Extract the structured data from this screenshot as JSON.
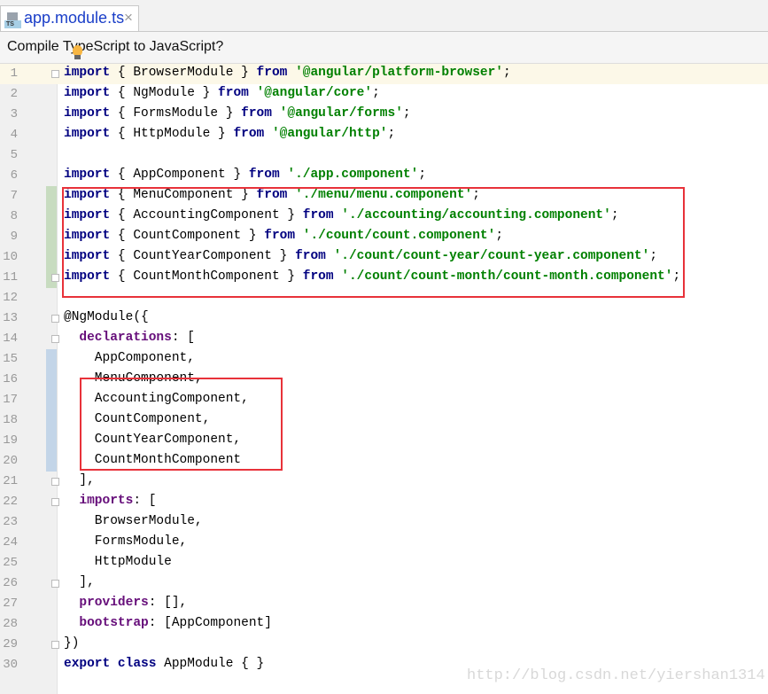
{
  "tab": {
    "title": "app.module.ts",
    "icon_label": "TS",
    "close": "×"
  },
  "notice": {
    "text": "Compile TypeScript to JavaScript?"
  },
  "colors": {
    "keyword": "#000080",
    "string": "#008000",
    "property": "#660e7a",
    "highlight_box": "#e8323a",
    "added_marker": "#c8dcc0",
    "modified_marker": "#c3d5e8"
  },
  "current_line": 1,
  "added_lines": [
    7,
    8,
    9,
    10,
    11
  ],
  "modified_lines": [
    15,
    16,
    17,
    18,
    19,
    20
  ],
  "fold_lines": [
    1,
    11,
    13,
    14,
    21,
    22,
    26,
    29
  ],
  "lines": [
    [
      [
        "kw",
        "import"
      ],
      [
        "p",
        " { BrowserModule } "
      ],
      [
        "kw",
        "from"
      ],
      [
        "p",
        " "
      ],
      [
        "str",
        "'@angular/platform-browser'"
      ],
      [
        "p",
        ";"
      ]
    ],
    [
      [
        "kw",
        "import"
      ],
      [
        "p",
        " { NgModule } "
      ],
      [
        "kw",
        "from"
      ],
      [
        "p",
        " "
      ],
      [
        "str",
        "'@angular/core'"
      ],
      [
        "p",
        ";"
      ]
    ],
    [
      [
        "kw",
        "import"
      ],
      [
        "p",
        " { FormsModule } "
      ],
      [
        "kw",
        "from"
      ],
      [
        "p",
        " "
      ],
      [
        "str",
        "'@angular/forms'"
      ],
      [
        "p",
        ";"
      ]
    ],
    [
      [
        "kw",
        "import"
      ],
      [
        "p",
        " { HttpModule } "
      ],
      [
        "kw",
        "from"
      ],
      [
        "p",
        " "
      ],
      [
        "str",
        "'@angular/http'"
      ],
      [
        "p",
        ";"
      ]
    ],
    [],
    [
      [
        "kw",
        "import"
      ],
      [
        "p",
        " { AppComponent } "
      ],
      [
        "kw",
        "from"
      ],
      [
        "p",
        " "
      ],
      [
        "str",
        "'./app.component'"
      ],
      [
        "p",
        ";"
      ]
    ],
    [
      [
        "kw",
        "import"
      ],
      [
        "p",
        " { MenuComponent } "
      ],
      [
        "kw",
        "from"
      ],
      [
        "p",
        " "
      ],
      [
        "str",
        "'./menu/menu.component'"
      ],
      [
        "p",
        ";"
      ]
    ],
    [
      [
        "kw",
        "import"
      ],
      [
        "p",
        " { AccountingComponent } "
      ],
      [
        "kw",
        "from"
      ],
      [
        "p",
        " "
      ],
      [
        "str",
        "'./accounting/accounting.component'"
      ],
      [
        "p",
        ";"
      ]
    ],
    [
      [
        "kw",
        "import"
      ],
      [
        "p",
        " { CountComponent } "
      ],
      [
        "kw",
        "from"
      ],
      [
        "p",
        " "
      ],
      [
        "str",
        "'./count/count.component'"
      ],
      [
        "p",
        ";"
      ]
    ],
    [
      [
        "kw",
        "import"
      ],
      [
        "p",
        " { CountYearComponent } "
      ],
      [
        "kw",
        "from"
      ],
      [
        "p",
        " "
      ],
      [
        "str",
        "'./count/count-year/count-year.component'"
      ],
      [
        "p",
        ";"
      ]
    ],
    [
      [
        "kw",
        "import"
      ],
      [
        "p",
        " { CountMonthComponent } "
      ],
      [
        "kw",
        "from"
      ],
      [
        "p",
        " "
      ],
      [
        "str",
        "'./count/count-month/count-month.component'"
      ],
      [
        "p",
        ";"
      ]
    ],
    [],
    [
      [
        "p",
        "@NgModule({"
      ]
    ],
    [
      [
        "p",
        "  "
      ],
      [
        "prop",
        "declarations"
      ],
      [
        "p",
        ": ["
      ]
    ],
    [
      [
        "p",
        "    AppComponent,"
      ]
    ],
    [
      [
        "p",
        "    MenuComponent,"
      ]
    ],
    [
      [
        "p",
        "    AccountingComponent,"
      ]
    ],
    [
      [
        "p",
        "    CountComponent,"
      ]
    ],
    [
      [
        "p",
        "    CountYearComponent,"
      ]
    ],
    [
      [
        "p",
        "    CountMonthComponent"
      ]
    ],
    [
      [
        "p",
        "  ],"
      ]
    ],
    [
      [
        "p",
        "  "
      ],
      [
        "prop",
        "imports"
      ],
      [
        "p",
        ": ["
      ]
    ],
    [
      [
        "p",
        "    BrowserModule,"
      ]
    ],
    [
      [
        "p",
        "    FormsModule,"
      ]
    ],
    [
      [
        "p",
        "    HttpModule"
      ]
    ],
    [
      [
        "p",
        "  ],"
      ]
    ],
    [
      [
        "p",
        "  "
      ],
      [
        "prop",
        "providers"
      ],
      [
        "p",
        ": [],"
      ]
    ],
    [
      [
        "p",
        "  "
      ],
      [
        "prop",
        "bootstrap"
      ],
      [
        "p",
        ": [AppComponent]"
      ]
    ],
    [
      [
        "p",
        "})"
      ]
    ],
    [
      [
        "kw",
        "export"
      ],
      [
        "p",
        " "
      ],
      [
        "kw",
        "class"
      ],
      [
        "p",
        " AppModule { }"
      ]
    ]
  ],
  "watermark": "http://blog.csdn.net/yiershan1314"
}
